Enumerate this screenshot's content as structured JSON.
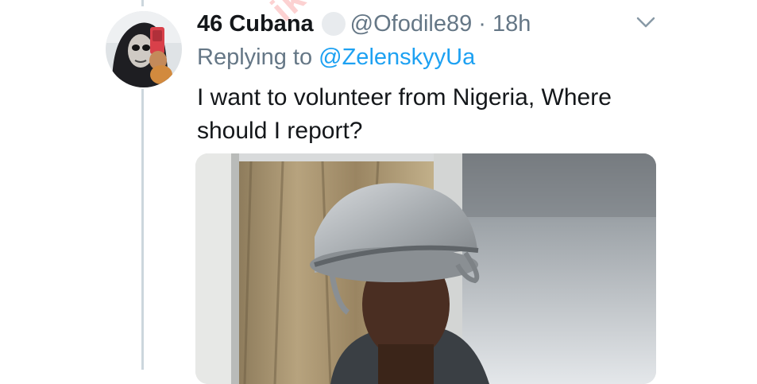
{
  "tweet": {
    "display_name": "46 Cubana",
    "handle": "@Ofodile89",
    "separator": "·",
    "time": "18h",
    "reply_prefix": "Replying to",
    "reply_to": "@ZelenskyyUa",
    "text": "I want to volunteer from Nigeria, Where should I report?"
  },
  "watermark": "ike",
  "icons": {
    "more": "chevron-down-icon",
    "verified": "verified-badge-icon"
  },
  "colors": {
    "link": "#1da1f2",
    "muted": "#657786",
    "text": "#14171a",
    "thread_line": "#ccd6dd"
  }
}
